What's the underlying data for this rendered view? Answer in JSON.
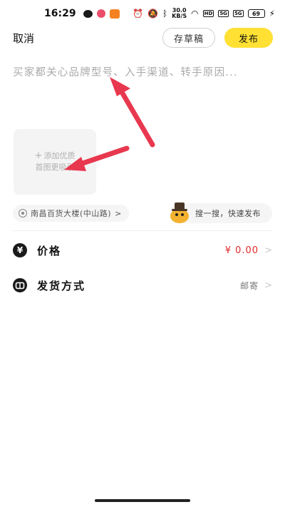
{
  "status_bar": {
    "time": "16:29",
    "net_speed_value": "30.0",
    "net_speed_unit": "KB/S",
    "hd_tag": "HD",
    "signal_label": "5G",
    "battery": "69"
  },
  "header": {
    "cancel_label": "取消",
    "draft_label": "存草稿",
    "publish_label": "发布"
  },
  "description": {
    "placeholder": "买家都关心品牌型号、入手渠道、转手原因..."
  },
  "add_photo": {
    "line1": "添加优质",
    "line2": "首图更吸引"
  },
  "location": {
    "label": "南昌百货大楼(中山路)"
  },
  "quick_publish": {
    "label": "搜一搜，快速发布"
  },
  "rows": {
    "price": {
      "label": "价格",
      "icon_glyph": "¥",
      "value": "¥ 0.00"
    },
    "shipping": {
      "label": "发货方式",
      "value": "邮寄"
    }
  },
  "colors": {
    "accent_yellow": "#ffe033",
    "price_red": "#e0282b",
    "annotation_red": "#e8384f"
  },
  "icons": [
    "wechat-icon",
    "app-icon",
    "taobao-icon",
    "alarm-icon",
    "mute-icon",
    "bluetooth-icon",
    "wifi-icon",
    "signal-icon",
    "battery-icon",
    "location-icon",
    "mascot-icon",
    "yen-icon",
    "shipping-icon",
    "chevron-right-icon"
  ]
}
